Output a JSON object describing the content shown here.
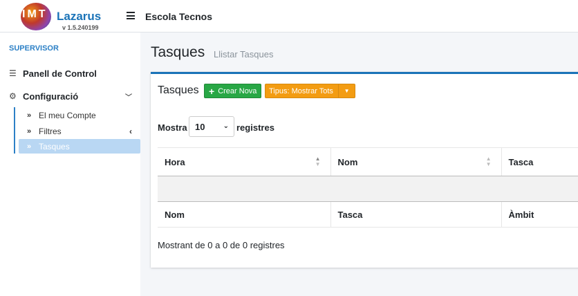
{
  "brand": {
    "logo_letters": "IMT",
    "name": "Lazarus",
    "version": "v 1.5.240199"
  },
  "header": {
    "school": "Escola Tecnos"
  },
  "sidebar": {
    "section": "SUPERVISOR",
    "items": [
      {
        "label": "Panell de Control",
        "icon": "list-icon"
      },
      {
        "label": "Configuració",
        "icon": "cogs-icon"
      }
    ],
    "subitems": [
      {
        "label": "El meu Compte"
      },
      {
        "label": "Filtres"
      },
      {
        "label": "Tasques",
        "active": true
      }
    ]
  },
  "page": {
    "title": "Tasques",
    "subtitle": "Llistar Tasques"
  },
  "card": {
    "title": "Tasques",
    "new_button": "Crear Nova",
    "type_button": "Tipus: Mostrar Tots"
  },
  "table": {
    "length_prefix": "Mostra",
    "length_value": "10",
    "length_suffix": "registres",
    "head": [
      "Hora",
      "Nom",
      "Tasca"
    ],
    "foot": [
      "Nom",
      "Tasca",
      "Àmbit"
    ],
    "info": "Mostrant de 0 a 0 de 0 registres"
  },
  "colors": {
    "primary": "#1a73b8",
    "success": "#28a745",
    "warning": "#f39c12",
    "active_bg": "#b9d7f3"
  }
}
